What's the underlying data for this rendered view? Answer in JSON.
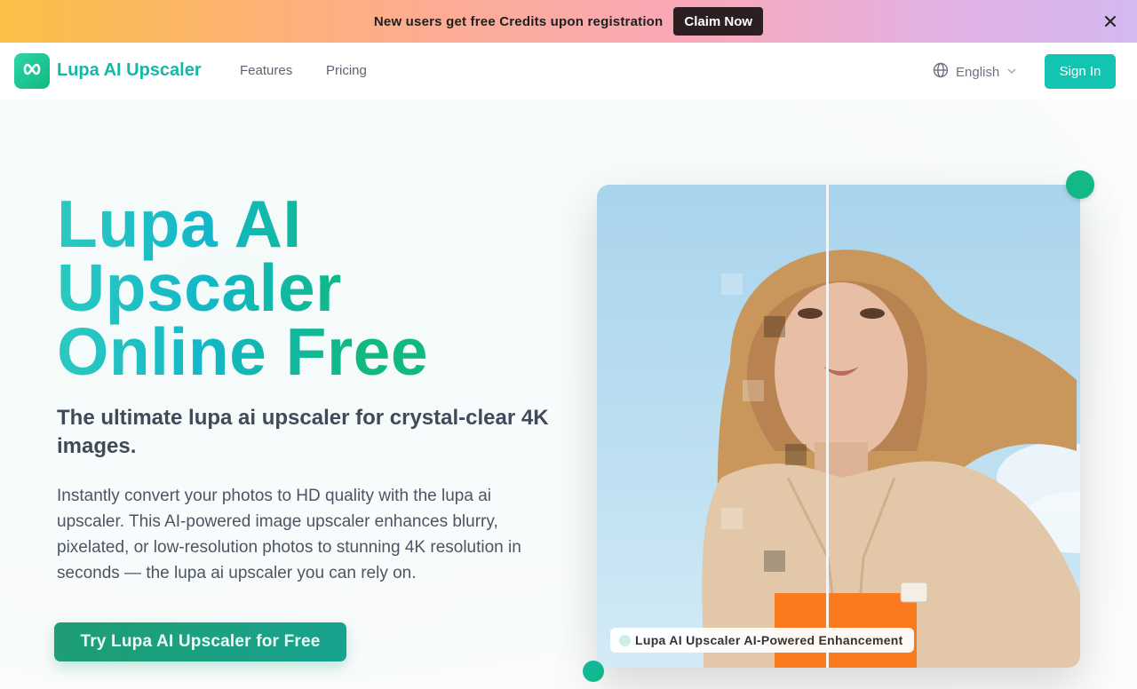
{
  "promo": {
    "text": "New users get free Credits upon registration",
    "button": "Claim Now",
    "close_icon": "close-icon"
  },
  "nav": {
    "brand": "Lupa AI Upscaler",
    "logo_icon": "infinity-icon",
    "links": [
      "Features",
      "Pricing"
    ],
    "language": "English",
    "language_icon": "globe-icon",
    "sign_in": "Sign In"
  },
  "hero": {
    "title_lines": [
      "Lupa AI",
      "Upscaler",
      "Online Free"
    ],
    "subtitle": "The ultimate lupa ai upscaler for crystal-clear 4K images.",
    "description": "Instantly convert your photos to HD quality with the lupa ai upscaler. This AI-powered image upscaler enhances blurry, pixelated, or low-resolution photos to stunning 4K resolution in seconds — the lupa ai upscaler you can rely on.",
    "cta": "Try Lupa AI Upscaler for Free",
    "image_label": "Lupa AI Upscaler AI-Powered Enhancement"
  },
  "colors": {
    "accent": "#14c4b3",
    "brand_green": "#10b981"
  }
}
